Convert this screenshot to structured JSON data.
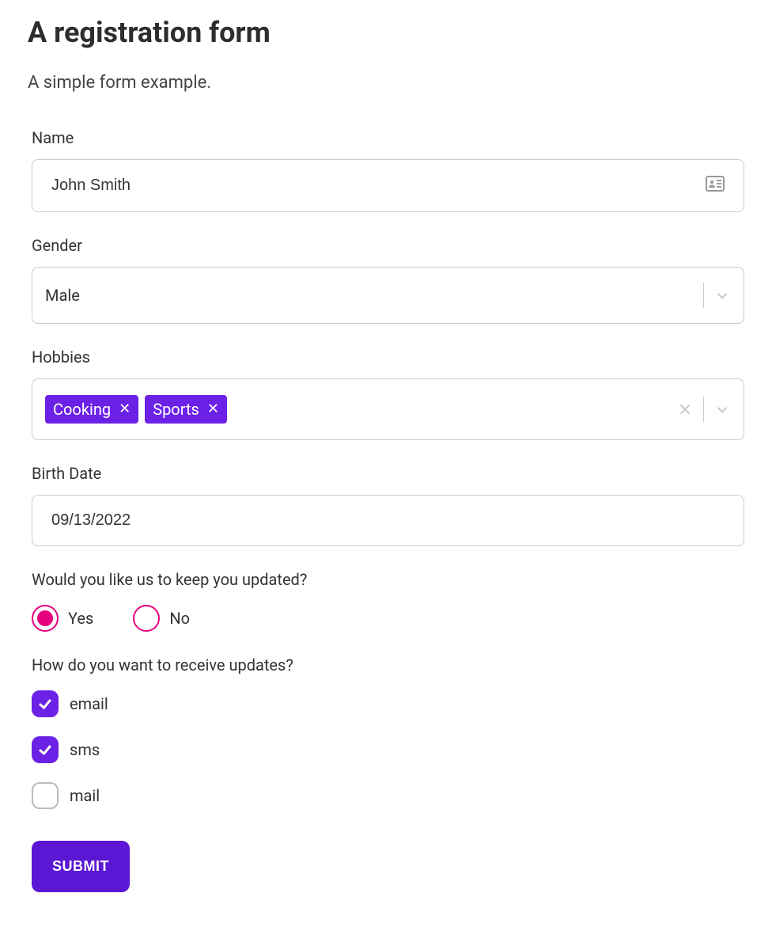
{
  "title": "A registration form",
  "subtitle": "A simple form example.",
  "fields": {
    "name": {
      "label": "Name",
      "value": "John Smith"
    },
    "gender": {
      "label": "Gender",
      "selected": "Male"
    },
    "hobbies": {
      "label": "Hobbies",
      "tags": [
        "Cooking",
        "Sports"
      ]
    },
    "birthdate": {
      "label": "Birth Date",
      "value": "09/13/2022"
    },
    "updates": {
      "label": "Would you like us to keep you updated?",
      "options": [
        "Yes",
        "No"
      ],
      "selected": "Yes"
    },
    "channels": {
      "label": "How do you want to receive updates?",
      "options": [
        {
          "label": "email",
          "checked": true
        },
        {
          "label": "sms",
          "checked": true
        },
        {
          "label": "mail",
          "checked": false
        }
      ]
    }
  },
  "submit_label": "SUBMIT",
  "colors": {
    "accent_purple": "#6c22e6",
    "accent_pink": "#e6007e"
  }
}
